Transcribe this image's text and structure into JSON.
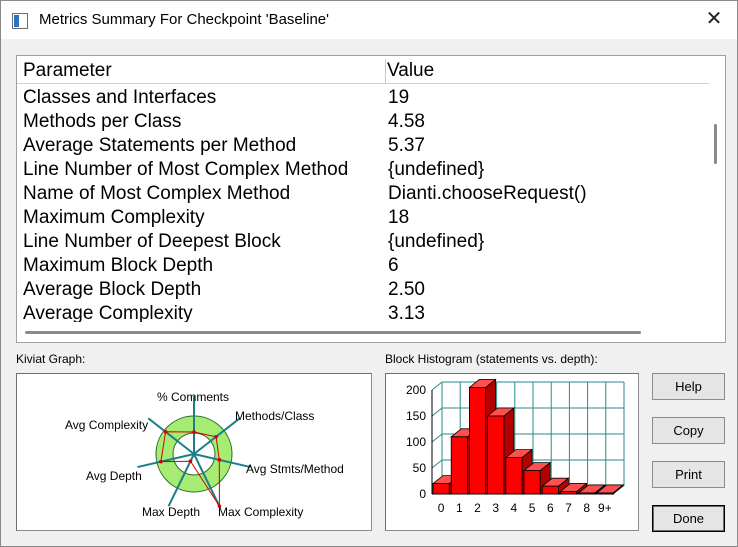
{
  "window": {
    "title": "Metrics Summary For Checkpoint 'Baseline'",
    "close_glyph": "✕"
  },
  "table": {
    "headers": [
      "Parameter",
      "Value"
    ],
    "rows": [
      [
        "Classes and Interfaces",
        "19"
      ],
      [
        "Methods per Class",
        "4.58"
      ],
      [
        "Average Statements per Method",
        "5.37"
      ],
      [
        "Line Number of Most Complex Method",
        "{undefined}"
      ],
      [
        "Name of Most Complex Method",
        "Dianti.chooseRequest()"
      ],
      [
        "Maximum Complexity",
        "18"
      ],
      [
        "Line Number of Deepest Block",
        "{undefined}"
      ],
      [
        "Maximum Block Depth",
        "6"
      ],
      [
        "Average Block Depth",
        "2.50"
      ],
      [
        "Average Complexity",
        "3.13"
      ]
    ]
  },
  "kiviat": {
    "label": "Kiviat Graph:",
    "axes": [
      "% Comments",
      "Methods/Class",
      "Avg Stmts/Method",
      "Max Complexity",
      "Max Depth",
      "Avg Depth",
      "Avg Complexity"
    ],
    "colors": {
      "ring": "#a6ec72",
      "polygon": "#d00000",
      "spokes": "#1b7f86"
    }
  },
  "histogram": {
    "label": "Block Histogram (statements vs. depth):",
    "bar_color": "#ff0000",
    "grid_color": "#2a8a8a"
  },
  "chart_data": {
    "type": "bar",
    "categories": [
      "0",
      "1",
      "2",
      "3",
      "4",
      "5",
      "6",
      "7",
      "8",
      "9+"
    ],
    "values": [
      20,
      110,
      205,
      150,
      70,
      45,
      15,
      5,
      2,
      2
    ],
    "ylim": [
      0,
      200
    ],
    "yticks": [
      "0",
      "50",
      "100",
      "150",
      "200"
    ]
  },
  "buttons": {
    "help": "Help",
    "copy": "Copy",
    "print": "Print",
    "done": "Done"
  }
}
